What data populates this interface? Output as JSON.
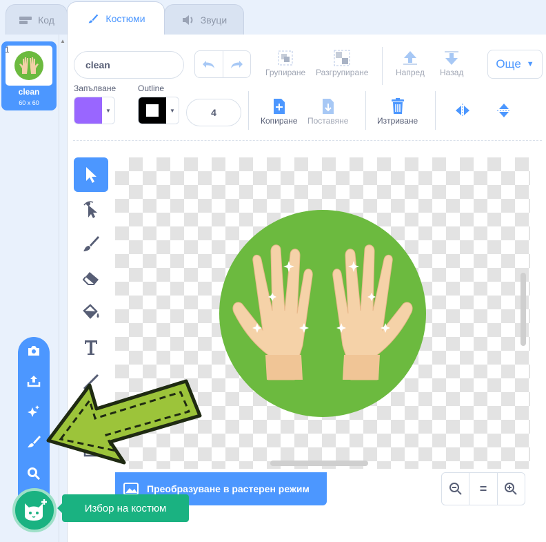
{
  "tabs": [
    {
      "label": "Код",
      "icon": "code-icon"
    },
    {
      "label": "Костюми",
      "icon": "brush-icon"
    },
    {
      "label": "Звуци",
      "icon": "speaker-icon"
    }
  ],
  "costumes": [
    {
      "number": "1",
      "name": "clean",
      "size": "60 x 60"
    }
  ],
  "editor": {
    "costume_name": "clean",
    "group_label": "Групиране",
    "ungroup_label": "Разгрупиране",
    "forward_label": "Напред",
    "backward_label": "Назад",
    "more_label": "Още",
    "fill_label": "Запълване",
    "outline_label": "Outline",
    "outline_width": "4",
    "copy_label": "Копиране",
    "paste_label": "Поставяне",
    "delete_label": "Изтриване",
    "convert_label": "Преобразуване в растерен режим",
    "zoom_reset": "="
  },
  "colors": {
    "fill": "#9966ff",
    "outline": "#000000",
    "accent": "#4c97ff",
    "add_button": "#1ab281",
    "circle": "#6cba3f"
  },
  "add_menu": {
    "items": [
      "camera-icon",
      "upload-icon",
      "surprise-icon",
      "paint-icon",
      "search-icon"
    ],
    "tooltip": "Избор на костюм"
  }
}
